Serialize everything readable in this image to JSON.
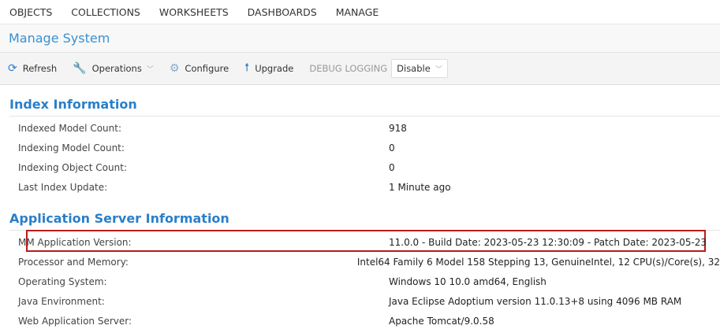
{
  "nav": [
    "OBJECTS",
    "COLLECTIONS",
    "WORKSHEETS",
    "DASHBOARDS",
    "MANAGE"
  ],
  "title": "Manage System",
  "toolbar": {
    "refresh": "Refresh",
    "operations": "Operations",
    "configure": "Configure",
    "upgrade": "Upgrade",
    "debug_label": "DEBUG LOGGING",
    "debug_value": "Disable"
  },
  "index": {
    "heading": "Index Information",
    "rows": [
      {
        "label": "Indexed Model Count:",
        "value": "918"
      },
      {
        "label": "Indexing Model Count:",
        "value": "0"
      },
      {
        "label": "Indexing Object Count:",
        "value": "0"
      },
      {
        "label": "Last Index Update:",
        "value": "1 Minute ago"
      }
    ]
  },
  "app": {
    "heading": "Application Server Information",
    "rows": [
      {
        "label": "MM Application Version:",
        "value": "11.0.0 - Build Date: 2023-05-23 12:30:09 - Patch Date: 2023-05-23"
      },
      {
        "label": "Processor and Memory:",
        "value": "Intel64 Family 6 Model 158 Stepping 13, GenuineIntel, 12 CPU(s)/Core(s), 32"
      },
      {
        "label": "Operating System:",
        "value": "Windows 10 10.0 amd64, English"
      },
      {
        "label": "Java Environment:",
        "value": "Java Eclipse Adoptium version 11.0.13+8 using 4096 MB RAM"
      },
      {
        "label": "Web Application Server:",
        "value": "Apache Tomcat/9.0.58"
      }
    ]
  }
}
